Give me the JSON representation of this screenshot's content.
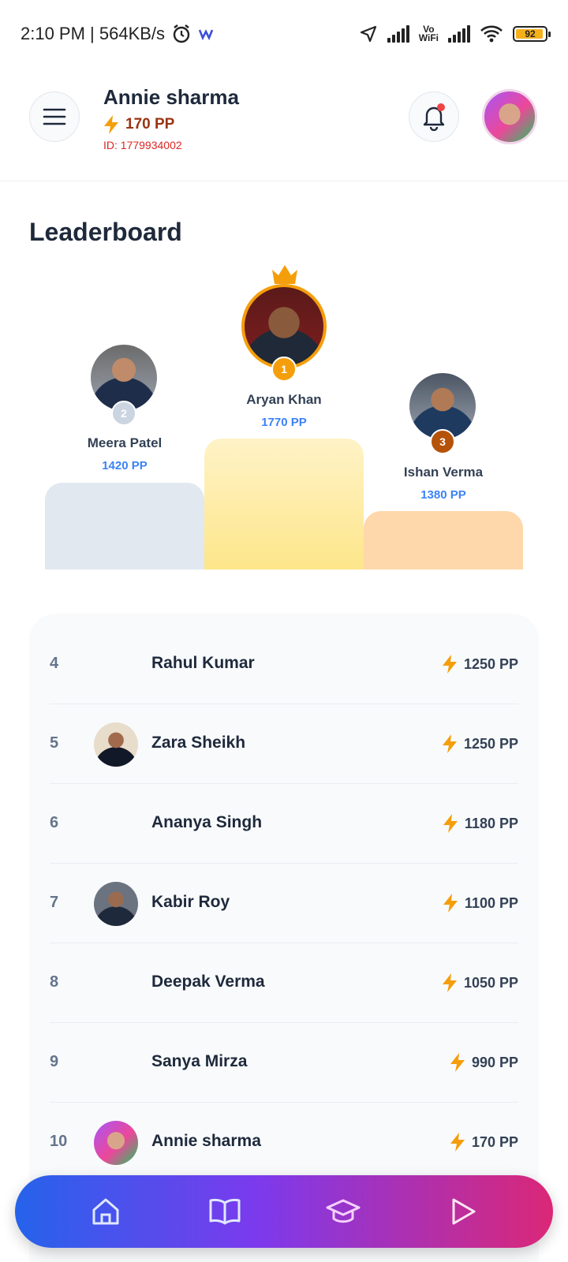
{
  "status_bar": {
    "time_speed": "2:10 PM | 564KB/s",
    "volte_label_top": "Vo",
    "volte_label_bottom": "WiFi",
    "battery": "92"
  },
  "header": {
    "user_name": "Annie sharma",
    "points": "170 PP",
    "user_id": "ID: 1779934002"
  },
  "page_title": "Leaderboard",
  "podium": {
    "first": {
      "rank": "1",
      "name": "Aryan Khan",
      "points": "1770 PP"
    },
    "second": {
      "rank": "2",
      "name": "Meera Patel",
      "points": "1420 PP"
    },
    "third": {
      "rank": "3",
      "name": "Ishan Verma",
      "points": "1380 PP"
    }
  },
  "list": [
    {
      "rank": "4",
      "name": "Rahul Kumar",
      "points": "1250 PP"
    },
    {
      "rank": "5",
      "name": "Zara Sheikh",
      "points": "1250 PP"
    },
    {
      "rank": "6",
      "name": "Ananya Singh",
      "points": "1180 PP"
    },
    {
      "rank": "7",
      "name": "Kabir Roy",
      "points": "1100 PP"
    },
    {
      "rank": "8",
      "name": "Deepak Verma",
      "points": "1050 PP"
    },
    {
      "rank": "9",
      "name": "Sanya Mirza",
      "points": "990 PP"
    },
    {
      "rank": "10",
      "name": "Annie sharma",
      "points": "170 PP"
    }
  ],
  "icons": {
    "menu": "menu-icon",
    "notification": "bell-icon",
    "points": "lightning-icon",
    "crown": "crown-icon",
    "nav": [
      "home-icon",
      "book-icon",
      "graduation-cap-icon",
      "play-icon"
    ]
  },
  "colors": {
    "accent_gold": "#f59e0b",
    "points_blue": "#3b82f6",
    "id_red": "#dc2626",
    "nav_gradient_start": "#2563eb",
    "nav_gradient_end": "#db2777"
  }
}
